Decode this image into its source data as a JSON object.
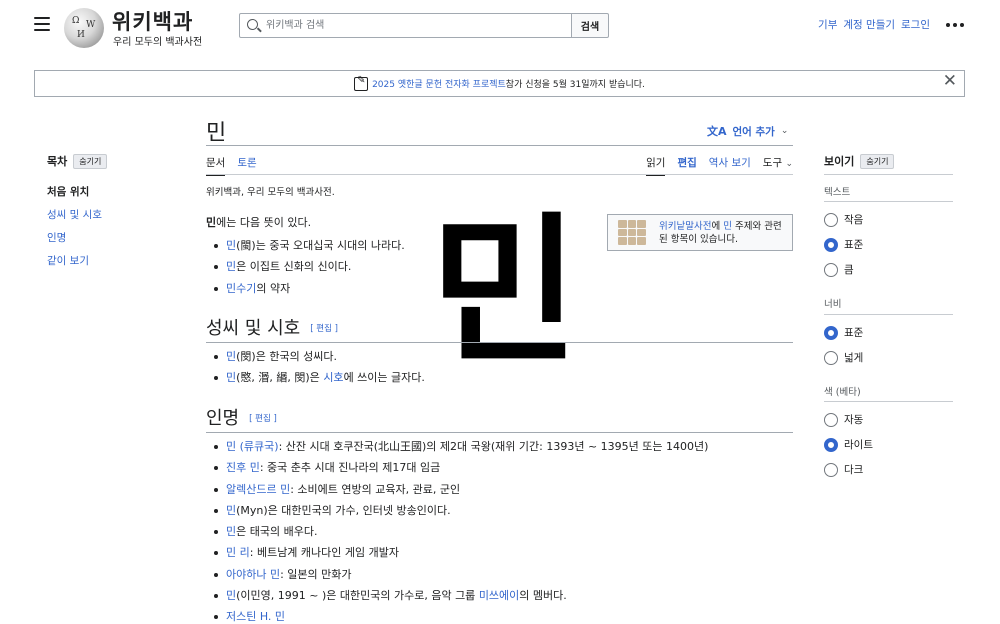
{
  "header": {
    "logo_title": "위키백과",
    "logo_tagline": "우리 모두의 백과사전",
    "search_placeholder": "위키백과 검색",
    "search_button": "검색",
    "links": [
      "기부",
      "계정 만들기",
      "로그인"
    ]
  },
  "banner": {
    "link_text": "2025 옛한글 문헌 전자화 프로젝트",
    "rest_text": " 참가 신청을 5월 31일까지 받습니다."
  },
  "toc": {
    "heading": "목차",
    "hide": "숨기기",
    "items": [
      "처음 위치",
      "성씨 및 시호",
      "인명",
      "같이 보기"
    ]
  },
  "page": {
    "title": "민",
    "add_languages": "언어 추가",
    "tabs_left": [
      "문서",
      "토론"
    ],
    "tabs_right": [
      "읽기",
      "편집",
      "역사 보기",
      "도구"
    ],
    "subtitle": "위키백과, 우리 모두의 백과사전.",
    "intro_bold": "민",
    "intro_rest": "에는 다음 뜻이 있다.",
    "glyph": "민",
    "edit_label": "[ 편집 ]"
  },
  "wiktionary": {
    "link": "위키낱말사전",
    "mid": "에 ",
    "term": "민",
    "rest": " 주제와 관련된 항목이 있습니다."
  },
  "intro_items": [
    {
      "link": "민",
      "text": "(閩)는 중국 오대십국 시대의 나라다."
    },
    {
      "link": "민",
      "text": "은 이집트 신화의 신이다."
    },
    {
      "link": "민수기",
      "text": "의 약자"
    }
  ],
  "section1": {
    "heading": "성씨 및 시호",
    "items": [
      {
        "link": "민",
        "text": "(閔)은 한국의 성씨다.",
        "link2": "",
        "text2": ""
      },
      {
        "link": "민",
        "text": "(愍, 湣, 緡, 閔)은 ",
        "link2": "시호",
        "text2": "에 쓰이는 글자다."
      }
    ]
  },
  "section2": {
    "heading": "인명",
    "items": [
      {
        "link": "민 (류큐국)",
        "text": ": 산잔 시대 호쿠잔국(北山王國)의 제2대 국왕(재위 기간: 1393년 ~ 1395년 또는 1400년)",
        "link2": "",
        "text2": ""
      },
      {
        "link": "진후 민",
        "text": ": 중국 춘추 시대 진나라의 제17대 임금",
        "link2": "",
        "text2": ""
      },
      {
        "link": "알렉산드르 민",
        "text": ": 소비에트 연방의 교육자, 관료, 군인",
        "link2": "",
        "text2": ""
      },
      {
        "link": "민",
        "text": "(Myn)은 대한민국의 가수, 인터넷 방송인이다.",
        "link2": "",
        "text2": ""
      },
      {
        "link": "민",
        "text": "은 태국의 배우다.",
        "link2": "",
        "text2": ""
      },
      {
        "link": "민 리",
        "text": ": 베트남계 캐나다인 게임 개발자",
        "link2": "",
        "text2": ""
      },
      {
        "link": "아야하나 민",
        "text": ": 일본의 만화가",
        "link2": "",
        "text2": ""
      },
      {
        "link": "민",
        "text": "(이민영, 1991 ~ )은 대한민국의 가수로, 음악 그룹 ",
        "link2": "미쓰에이",
        "text2": "의 멤버다."
      },
      {
        "link": "저스틴 H. 민",
        "text": "",
        "link2": "",
        "text2": ""
      }
    ]
  },
  "appearance": {
    "heading": "보이기",
    "hide": "숨기기",
    "text_label": "텍스트",
    "text_options": [
      "작음",
      "표준",
      "큼"
    ],
    "text_selected": 1,
    "width_label": "너비",
    "width_options": [
      "표준",
      "넓게"
    ],
    "width_selected": 0,
    "color_label": "색 (베타)",
    "color_options": [
      "자동",
      "라이트",
      "다크"
    ],
    "color_selected": 1
  },
  "colors": {
    "link": "#3366cc",
    "text": "#202122",
    "border": "#a2a9b1"
  }
}
